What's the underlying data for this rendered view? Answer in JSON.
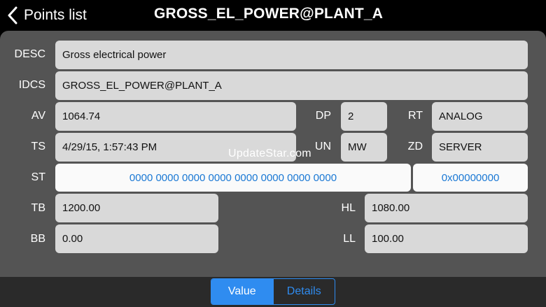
{
  "nav": {
    "back_label": "Points list",
    "title": "GROSS_EL_POWER@PLANT_A"
  },
  "fields": {
    "desc": {
      "label": "DESC",
      "value": "Gross electrical power"
    },
    "idcs": {
      "label": "IDCS",
      "value": "GROSS_EL_POWER@PLANT_A"
    },
    "av": {
      "label": "AV",
      "value": "1064.74"
    },
    "dp": {
      "label": "DP",
      "value": "2"
    },
    "rt": {
      "label": "RT",
      "value": "ANALOG"
    },
    "ts": {
      "label": "TS",
      "value": "4/29/15, 1:57:43 PM"
    },
    "un": {
      "label": "UN",
      "value": "MW"
    },
    "zd": {
      "label": "ZD",
      "value": "SERVER"
    },
    "st": {
      "label": "ST",
      "bits": "0000 0000 0000 0000 0000 0000 0000 0000",
      "hex": "0x00000000"
    },
    "tb": {
      "label": "TB",
      "value": "1200.00"
    },
    "hl": {
      "label": "HL",
      "value": "1080.00"
    },
    "bb": {
      "label": "BB",
      "value": "0.00"
    },
    "ll": {
      "label": "LL",
      "value": "100.00"
    }
  },
  "watermark": "UpdateStar.com",
  "tabs": {
    "value": "Value",
    "details": "Details",
    "selected": "Value"
  },
  "colors": {
    "accent": "#2f8cf0",
    "field_bg": "#d9d9d9",
    "panel_bg": "#545454",
    "status_text": "#1a78d4"
  }
}
